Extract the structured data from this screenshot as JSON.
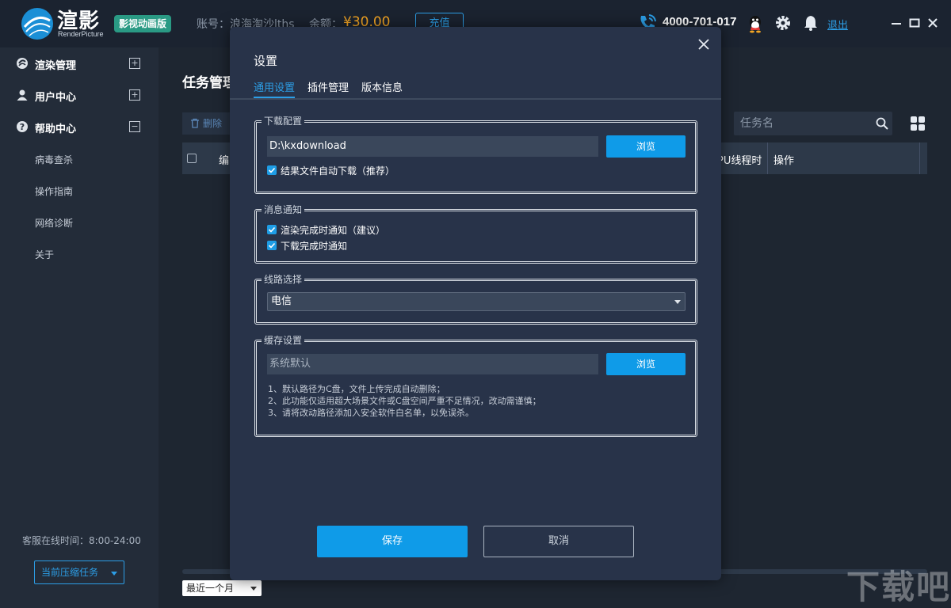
{
  "brand": {
    "title": "渲影",
    "subtitle": "RenderPicture",
    "edition": "影视动画版"
  },
  "header": {
    "account": "账号：浪海淘沙lths",
    "balance_label": "余额：",
    "balance_value": "¥30.00",
    "recharge": "充值",
    "phone": "4000-701-017",
    "logout": "退出"
  },
  "sidebar": {
    "items": [
      {
        "label": "渲染管理",
        "toggle": "+"
      },
      {
        "label": "用户中心",
        "toggle": "+"
      },
      {
        "label": "帮助中心",
        "toggle": "−"
      }
    ],
    "help_sub": [
      "病毒查杀",
      "操作指南",
      "网络诊断",
      "关于"
    ],
    "service_hours": "客服在线时间：8:00-24:00",
    "current_task": "当前压缩任务"
  },
  "main": {
    "title": "任务管理",
    "delete": "删除",
    "search_placeholder": "任务名",
    "columns": [
      "编",
      "PU线程时",
      "操作"
    ],
    "period": "最近一个月"
  },
  "dialog": {
    "title": "设置",
    "tabs": [
      "通用设置",
      "插件管理",
      "版本信息"
    ],
    "download": {
      "legend": "下载配置",
      "path": "D:\\kxdownload",
      "browse": "浏览",
      "auto_download": "结果文件自动下载（推荐）"
    },
    "notify": {
      "legend": "消息通知",
      "render_done": "渲染完成时通知（建议）",
      "download_done": "下载完成时通知"
    },
    "route": {
      "legend": "线路选择",
      "selected": "电信"
    },
    "cache": {
      "legend": "缓存设置",
      "path": "系统默认",
      "browse": "浏览",
      "notes": [
        "1、默认路径为C盘，文件上传完成自动删除；",
        "2、此功能仅适用超大场景文件或C盘空间严重不足情况，改动需谨慎；",
        "3、请将改动路径添加入安全软件白名单，以免误杀。"
      ]
    },
    "save": "保存",
    "cancel": "取消"
  },
  "watermark": "下载吧",
  "colors": {
    "accent": "#0f9be8",
    "link": "#2c9ee6",
    "balance": "#f5a623",
    "edition_badge": "#2a9a84"
  }
}
